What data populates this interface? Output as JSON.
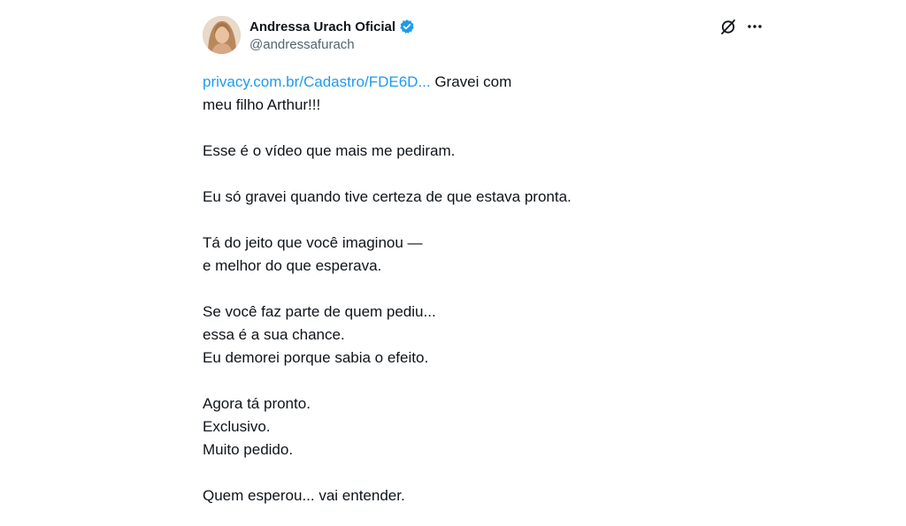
{
  "author": {
    "display_name": "Andressa Urach Oficial",
    "handle": "@andressafurach",
    "verified_icon": "verified-badge-icon",
    "verified_color": "#1d9bf0"
  },
  "actions": {
    "grok_icon": "grok-icon",
    "more_icon": "more-options-icon"
  },
  "tweet": {
    "link_text": "privacy.com.br/Cadastro/FDE6D...",
    "line1_rest": " Gravei com",
    "line2": "meu filho Arthur!!!",
    "line3": "Esse é o vídeo que mais me pediram.",
    "line4": "Eu só gravei quando tive certeza de que estava pronta.",
    "line5": "Tá do jeito que você imaginou —",
    "line6": "e melhor do que esperava.",
    "line7": "Se você faz parte de quem pediu...",
    "line8": "essa é a sua chance.",
    "line9": "Eu demorei porque sabia o efeito.",
    "line10": "Agora tá pronto.",
    "line11": "Exclusivo.",
    "line12": "Muito pedido.",
    "line13": "Quem esperou... vai entender."
  },
  "colors": {
    "link": "#1d9bf0",
    "text": "#0f1419",
    "secondary": "#536471"
  }
}
